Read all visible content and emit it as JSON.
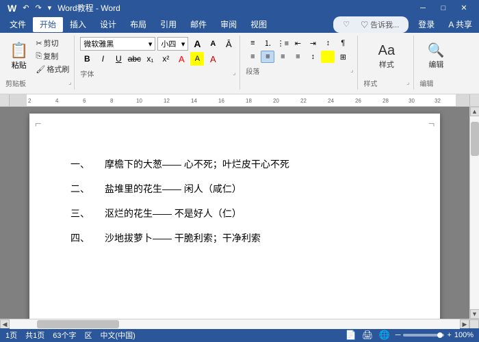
{
  "titleBar": {
    "title": "Word教程 - Word",
    "quickAccess": [
      "↶",
      "↷"
    ],
    "winControls": [
      "─",
      "□",
      "✕"
    ]
  },
  "menuBar": {
    "items": [
      "文件",
      "开始",
      "插入",
      "设计",
      "布局",
      "引用",
      "邮件",
      "审阅",
      "视图"
    ],
    "activeItem": "开始",
    "searchPlaceholder": "♡ 告诉我...",
    "loginLabel": "登录",
    "shareLabel": "A 共享"
  },
  "ribbon": {
    "groups": [
      {
        "name": "clipboard",
        "label": "剪贴板"
      },
      {
        "name": "font",
        "label": "字体"
      },
      {
        "name": "paragraph",
        "label": "段落"
      },
      {
        "name": "styles",
        "label": "样式"
      },
      {
        "name": "editing",
        "label": "编辑"
      }
    ],
    "fontName": "微软雅黑",
    "fontSize": "小四",
    "pasteLabel": "粘贴",
    "cutLabel": "剪切",
    "copyLabel": "复制",
    "formatPainterLabel": "格式刷",
    "stylesLabel": "样式",
    "editingLabel": "编辑"
  },
  "document": {
    "paragraphs": [
      {
        "num": "一、",
        "text": "摩檐下的大葱—— 心不死；叶烂皮干心不死"
      },
      {
        "num": "二、",
        "text": "盐堆里的花生—— 闲人（咸仁）"
      },
      {
        "num": "三、",
        "text": "沤烂的花生—— 不是好人（仁）"
      },
      {
        "num": "四、",
        "text": "沙地拔萝卜—— 干脆利索；干净利索"
      }
    ]
  },
  "statusBar": {
    "page": "1页",
    "totalPages": "共1页",
    "wordCount": "63个字",
    "section": "区",
    "language": "中文(中国)",
    "zoomLevel": "100%"
  }
}
